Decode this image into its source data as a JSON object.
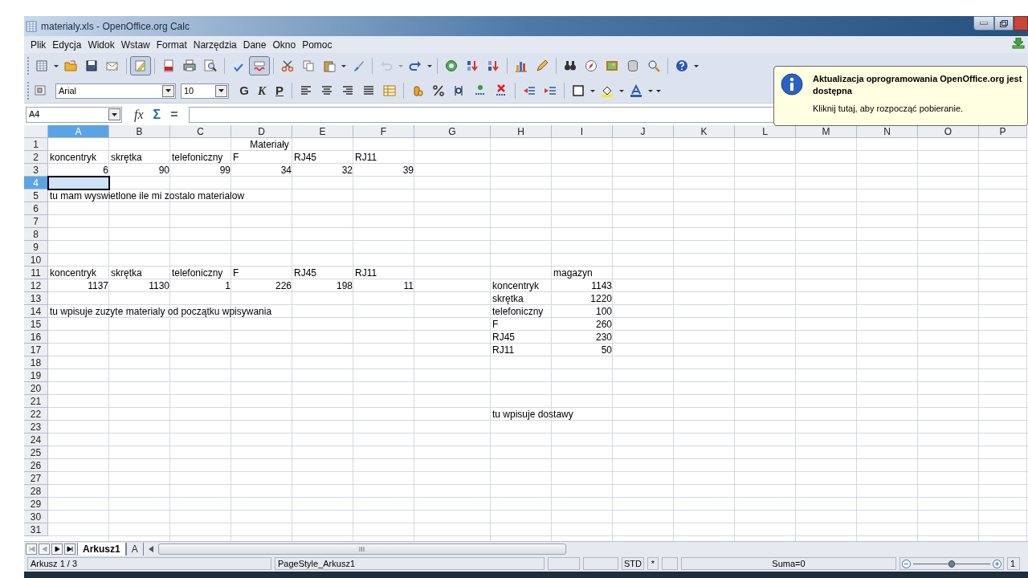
{
  "window": {
    "title": "materialy.xls - OpenOffice.org Calc"
  },
  "menu": [
    {
      "label": "Plik"
    },
    {
      "label": "Edycja"
    },
    {
      "label": "Widok"
    },
    {
      "label": "Wstaw"
    },
    {
      "label": "Format"
    },
    {
      "label": "Narzędzia"
    },
    {
      "label": "Dane"
    },
    {
      "label": "Okno"
    },
    {
      "label": "Pomoc"
    }
  ],
  "toolbar_standard": [
    {
      "kind": "new",
      "pressed": false,
      "disabled": false
    },
    {
      "kind": "caret",
      "pressed": false,
      "disabled": false
    },
    {
      "kind": "open",
      "pressed": false,
      "disabled": false
    },
    {
      "kind": "save",
      "pressed": false,
      "disabled": false
    },
    {
      "kind": "mail",
      "pressed": false,
      "disabled": false
    },
    {
      "kind": "sep"
    },
    {
      "kind": "edit",
      "pressed": true,
      "disabled": false
    },
    {
      "kind": "sep"
    },
    {
      "kind": "pdf",
      "pressed": false,
      "disabled": false
    },
    {
      "kind": "print",
      "pressed": false,
      "disabled": false
    },
    {
      "kind": "preview",
      "pressed": false,
      "disabled": false
    },
    {
      "kind": "sep"
    },
    {
      "kind": "spell",
      "pressed": false,
      "disabled": false
    },
    {
      "kind": "autospell",
      "pressed": true,
      "disabled": false
    },
    {
      "kind": "sep"
    },
    {
      "kind": "cut",
      "pressed": false,
      "disabled": false
    },
    {
      "kind": "copy",
      "pressed": false,
      "disabled": false
    },
    {
      "kind": "paste",
      "pressed": false,
      "disabled": false
    },
    {
      "kind": "caret",
      "pressed": false,
      "disabled": false
    },
    {
      "kind": "brush",
      "pressed": false,
      "disabled": false
    },
    {
      "kind": "sep"
    },
    {
      "kind": "undo",
      "pressed": false,
      "disabled": true
    },
    {
      "kind": "caret",
      "pressed": false,
      "disabled": true
    },
    {
      "kind": "redo",
      "pressed": false,
      "disabled": false
    },
    {
      "kind": "caret",
      "pressed": false,
      "disabled": false
    },
    {
      "kind": "sep"
    },
    {
      "kind": "globe",
      "pressed": false,
      "disabled": false
    },
    {
      "kind": "sortasc",
      "pressed": false,
      "disabled": false
    },
    {
      "kind": "sortdesc",
      "pressed": false,
      "disabled": false
    },
    {
      "kind": "sep"
    },
    {
      "kind": "chart",
      "pressed": false,
      "disabled": false
    },
    {
      "kind": "pencil",
      "pressed": false,
      "disabled": false
    },
    {
      "kind": "sep"
    },
    {
      "kind": "binoculars",
      "pressed": false,
      "disabled": false
    },
    {
      "kind": "compass",
      "pressed": false,
      "disabled": false
    },
    {
      "kind": "gallery",
      "pressed": false,
      "disabled": false
    },
    {
      "kind": "database",
      "pressed": false,
      "disabled": false
    },
    {
      "kind": "zoom",
      "pressed": false,
      "disabled": false
    },
    {
      "kind": "sep"
    },
    {
      "kind": "help",
      "pressed": false,
      "disabled": false
    },
    {
      "kind": "more",
      "pressed": false,
      "disabled": false
    }
  ],
  "toolbar_format": {
    "font": "Arial",
    "size": "10",
    "style_buttons": [
      {
        "label": "G",
        "kind": "bold"
      },
      {
        "label": "K",
        "kind": "italic"
      },
      {
        "label": "P",
        "kind": "underline"
      }
    ],
    "icons": [
      {
        "kind": "sep"
      },
      {
        "kind": "alignleft"
      },
      {
        "kind": "aligncenter"
      },
      {
        "kind": "alignright"
      },
      {
        "kind": "justify"
      },
      {
        "kind": "merge"
      },
      {
        "kind": "sep"
      },
      {
        "kind": "coins"
      },
      {
        "kind": "percent"
      },
      {
        "kind": "numfmt"
      },
      {
        "kind": "decadd"
      },
      {
        "kind": "decdel"
      },
      {
        "kind": "sep"
      },
      {
        "kind": "indentdec"
      },
      {
        "kind": "indentinc"
      },
      {
        "kind": "sep"
      },
      {
        "kind": "border"
      },
      {
        "kind": "caret"
      },
      {
        "kind": "bgcolor"
      },
      {
        "kind": "caret"
      },
      {
        "kind": "fontcolor"
      },
      {
        "kind": "caret"
      },
      {
        "kind": "more"
      }
    ]
  },
  "formula_bar": {
    "name_box": "A4",
    "buttons": [
      "fx",
      "Σ",
      "="
    ]
  },
  "columns": [
    {
      "label": "A",
      "selected": true
    },
    {
      "label": "B",
      "selected": false
    },
    {
      "label": "C",
      "selected": false
    },
    {
      "label": "D",
      "selected": false
    },
    {
      "label": "E",
      "selected": false
    },
    {
      "label": "F",
      "selected": false
    },
    {
      "label": "G",
      "selected": false
    },
    {
      "label": "H",
      "selected": false
    },
    {
      "label": "I",
      "selected": false
    },
    {
      "label": "J",
      "selected": false
    },
    {
      "label": "K",
      "selected": false
    },
    {
      "label": "L",
      "selected": false
    },
    {
      "label": "M",
      "selected": false
    },
    {
      "label": "N",
      "selected": false
    },
    {
      "label": "O",
      "selected": false
    },
    {
      "label": "P",
      "selected": false
    }
  ],
  "rows": [
    {
      "number": "1",
      "selected": false
    },
    {
      "number": "2",
      "selected": false
    },
    {
      "number": "3",
      "selected": false
    },
    {
      "number": "4",
      "selected": true
    },
    {
      "number": "5",
      "selected": false
    },
    {
      "number": "6",
      "selected": false
    },
    {
      "number": "7",
      "selected": false
    },
    {
      "number": "8",
      "selected": false
    },
    {
      "number": "9",
      "selected": false
    },
    {
      "number": "10",
      "selected": false
    },
    {
      "number": "11",
      "selected": false
    },
    {
      "number": "12",
      "selected": false
    },
    {
      "number": "13",
      "selected": false
    },
    {
      "number": "14",
      "selected": false
    },
    {
      "number": "15",
      "selected": false
    },
    {
      "number": "16",
      "selected": false
    },
    {
      "number": "17",
      "selected": false
    },
    {
      "number": "18",
      "selected": false
    },
    {
      "number": "19",
      "selected": false
    },
    {
      "number": "20",
      "selected": false
    },
    {
      "number": "21",
      "selected": false
    },
    {
      "number": "22",
      "selected": false
    },
    {
      "number": "23",
      "selected": false
    },
    {
      "number": "24",
      "selected": false
    },
    {
      "number": "25",
      "selected": false
    },
    {
      "number": "26",
      "selected": false
    },
    {
      "number": "27",
      "selected": false
    },
    {
      "number": "28",
      "selected": false
    },
    {
      "number": "29",
      "selected": false
    },
    {
      "number": "30",
      "selected": false
    },
    {
      "number": "31",
      "selected": false
    }
  ],
  "sheet": {
    "title": "Materiały",
    "remaining": {
      "labels": [
        "koncentryk",
        "skrętka",
        "telefoniczny",
        "F",
        "RJ45",
        "RJ11"
      ],
      "values": [
        "6",
        "90",
        "99",
        "34",
        "32",
        "39"
      ]
    },
    "remaining_note": "tu mam wyswietlone ile mi zostalo materialow",
    "used": {
      "labels": [
        "koncentryk",
        "skrętka",
        "telefoniczny",
        "F",
        "RJ45",
        "RJ11"
      ],
      "values": [
        "1137",
        "1130",
        "1",
        "226",
        "198",
        "11"
      ]
    },
    "used_note": "tu wpisuje zuzyte materialy od początku wpisywania",
    "stock": {
      "heading": "magazyn",
      "items": [
        {
          "name": "koncentryk",
          "quantity": "1143"
        },
        {
          "name": "skrętka",
          "quantity": "1220"
        },
        {
          "name": "telefoniczny",
          "quantity": "100"
        },
        {
          "name": "F",
          "quantity": "260"
        },
        {
          "name": "RJ45",
          "quantity": "230"
        },
        {
          "name": "RJ11",
          "quantity": "50"
        }
      ]
    },
    "deliveries_note": "tu wpisuje dostawy"
  },
  "sheet_tabs": [
    {
      "label": "Arkusz1",
      "selected": true
    },
    {
      "label": "A",
      "selected": false
    }
  ],
  "status_bar": {
    "sheet": "Arkusz 1 / 3",
    "page_style": "PageStyle_Arkusz1",
    "mode": "STD",
    "modified": "*",
    "sum": "Suma=0",
    "zoom": {
      "level": 0.5
    },
    "zoom_percent": "1"
  },
  "notification": {
    "title": "Aktualizacja oprogramowania OpenOffice.org jest dostępna",
    "text": "Kliknij tutaj, aby rozpocząć pobieranie."
  }
}
